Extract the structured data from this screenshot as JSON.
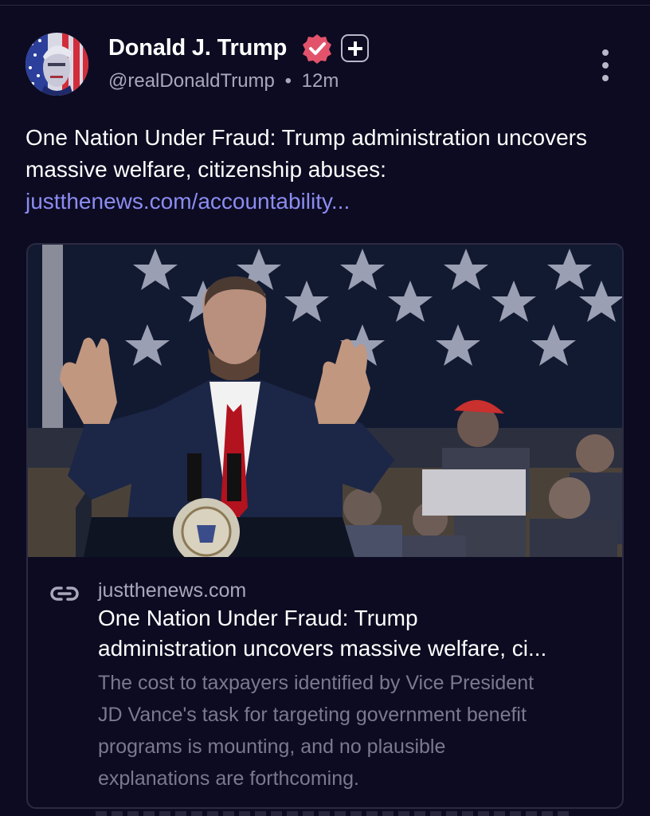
{
  "post": {
    "author": {
      "name": "Donald J. Trump",
      "handle": "@realDonaldTrump",
      "separator": "•",
      "time": "12m"
    },
    "text": "One Nation Under Fraud: Trump administration uncovers massive welfare, citizenship abuses:",
    "link_text": "justthenews.com/accountability...",
    "card": {
      "domain": "justthenews.com",
      "title_lines": [
        "One Nation Under Fraud: Trump",
        "administration uncovers massive welfare, ci..."
      ],
      "description_lines": [
        "The cost to taxpayers identified by Vice President",
        "JD Vance's task for targeting government benefit",
        "programs is mounting, and no plausible",
        "explanations are forthcoming."
      ]
    }
  },
  "icons": {
    "verified": "verified-badge-icon",
    "plus": "plus-icon",
    "more": "more-vertical-icon",
    "link": "link-icon"
  },
  "colors": {
    "background": "#0c0b21",
    "link": "#8c8cf2",
    "verified": "#e2536b",
    "muted_text": "#a9a8bb",
    "description_text": "#7a7990",
    "card_border": "#2b2a42"
  }
}
